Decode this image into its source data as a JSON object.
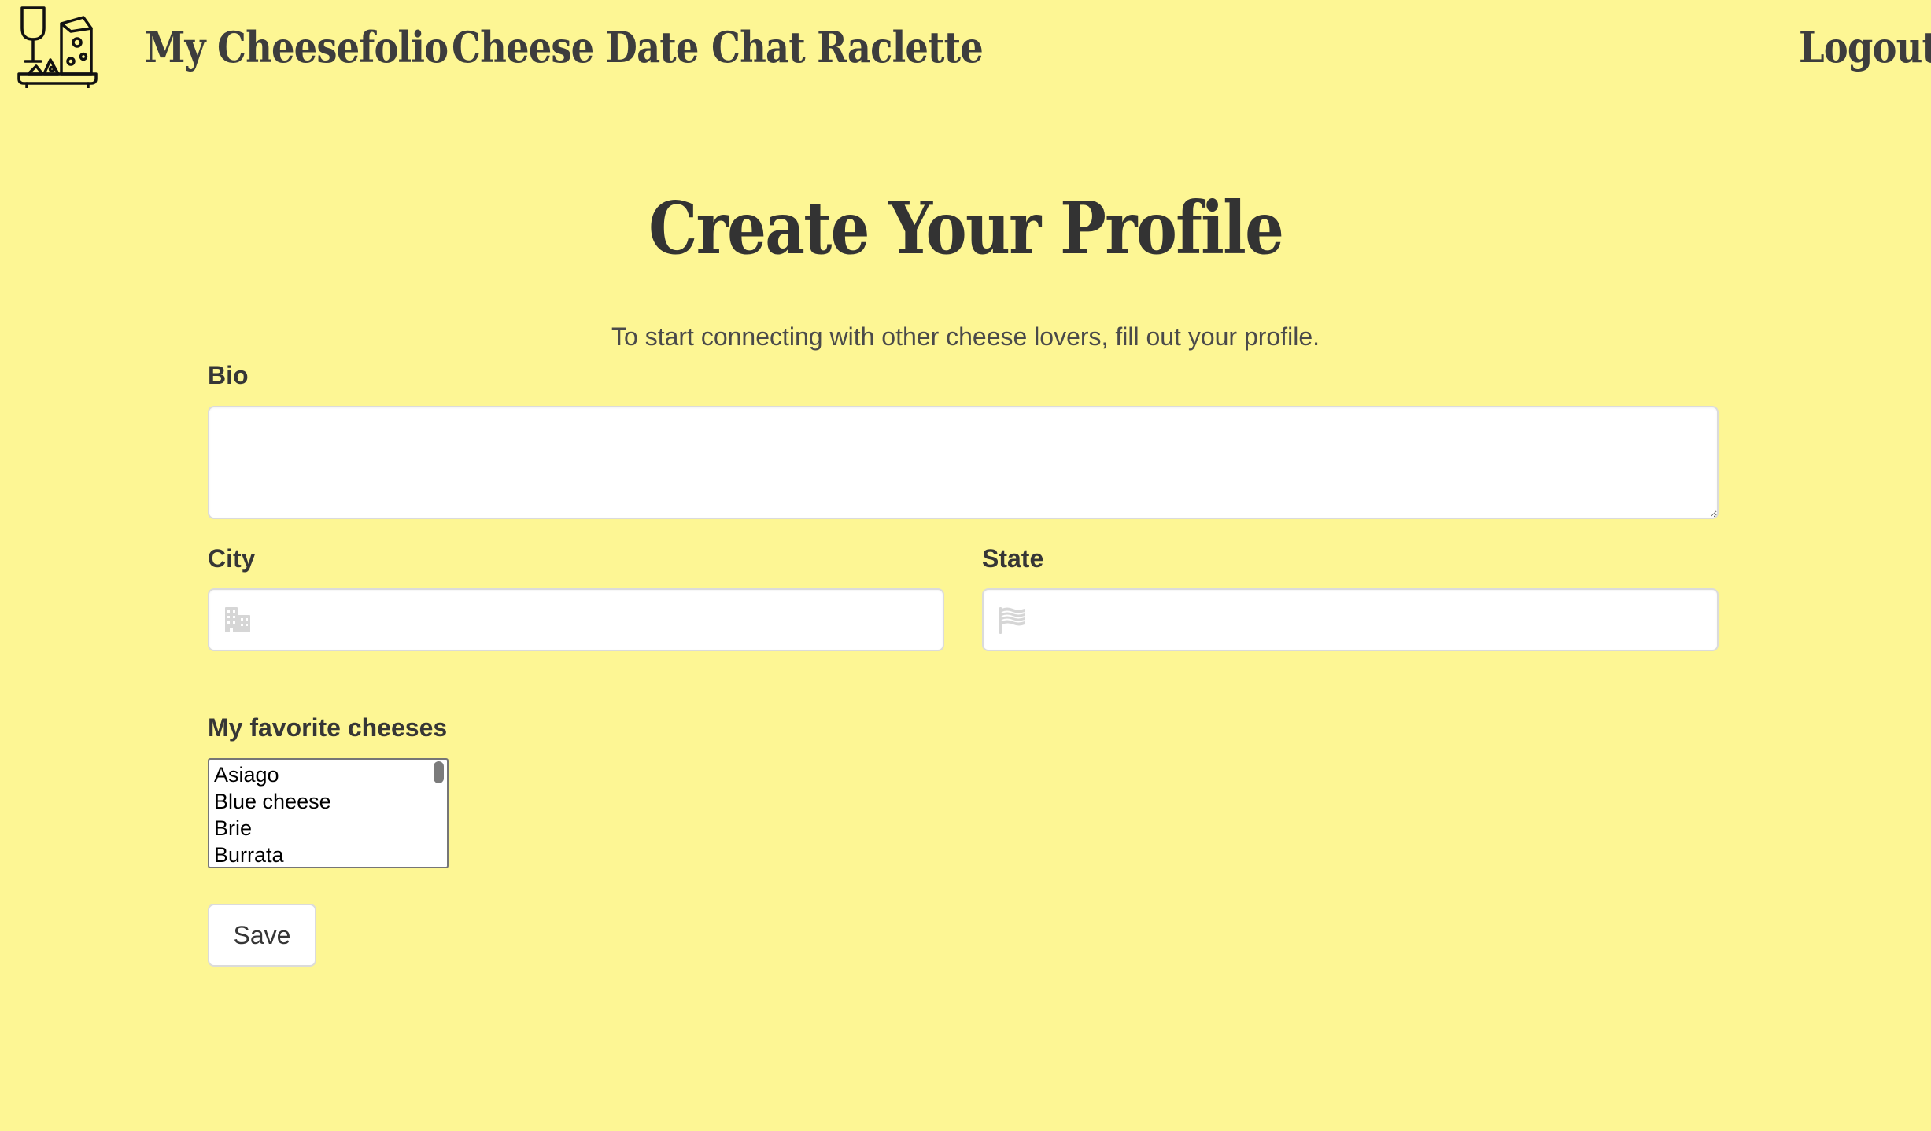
{
  "nav": {
    "logo_icon": "cheese-wine-board-icon",
    "items": [
      {
        "label": "My Cheesefolio"
      },
      {
        "label": "Cheese Date"
      },
      {
        "label": "Chat Raclette"
      }
    ],
    "logout_label": "Logout"
  },
  "page": {
    "title": "Create Your Profile",
    "subtitle": "To start connecting with other cheese lovers, fill out your profile."
  },
  "form": {
    "bio": {
      "label": "Bio",
      "value": ""
    },
    "city": {
      "label": "City",
      "value": "",
      "icon": "city-icon"
    },
    "state": {
      "label": "State",
      "value": "",
      "icon": "flag-icon"
    },
    "cheeses": {
      "label": "My favorite cheeses",
      "options": [
        "Asiago",
        "Blue cheese",
        "Brie",
        "Burrata"
      ]
    },
    "save_label": "Save"
  },
  "colors": {
    "background": "#fdf694",
    "text": "#363636",
    "border": "#dbdbdb"
  }
}
